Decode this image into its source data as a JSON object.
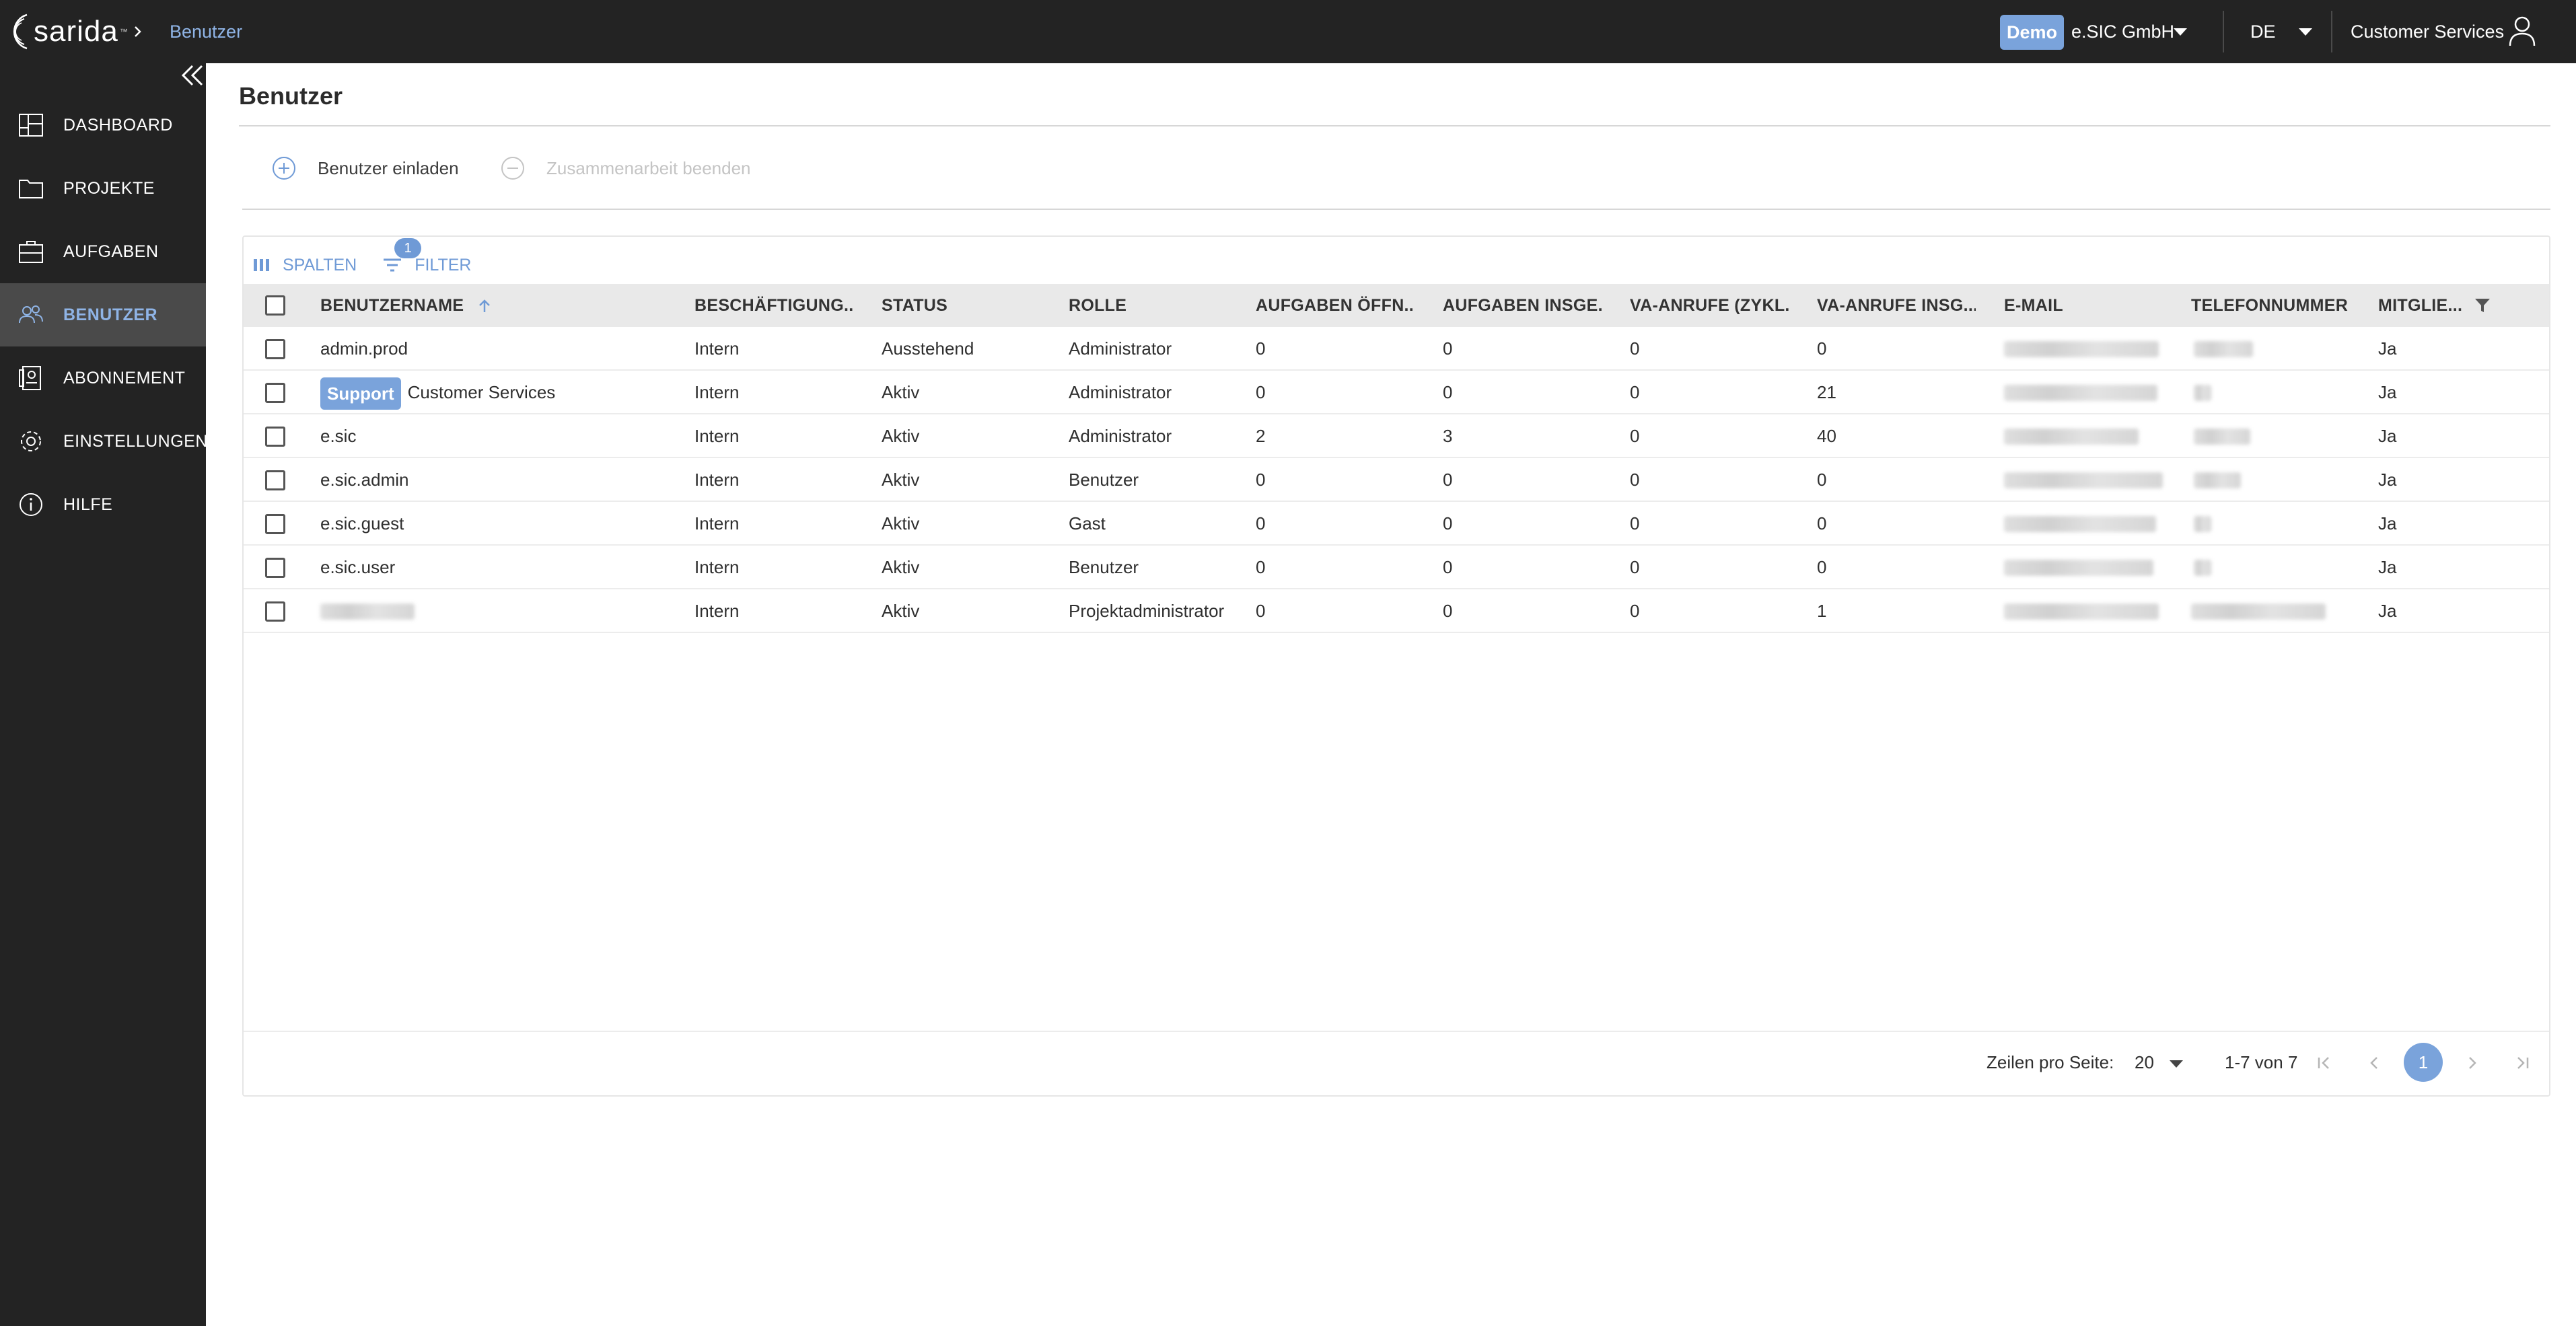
{
  "app": {
    "logo_text": "sarida",
    "breadcrumb_current": "Benutzer",
    "tenant_badge": "Demo",
    "company": "e.SIC GmbH",
    "language": "DE",
    "user": "Customer Services",
    "accent_color": "#7aa3db"
  },
  "sidebar": {
    "items": [
      {
        "label": "DASHBOARD",
        "icon": "dashboard-icon"
      },
      {
        "label": "PROJEKTE",
        "icon": "folder-icon"
      },
      {
        "label": "AUFGABEN",
        "icon": "tasks-icon"
      },
      {
        "label": "BENUTZER",
        "icon": "users-icon",
        "active": true
      },
      {
        "label": "ABONNEMENT",
        "icon": "subscription-icon"
      },
      {
        "label": "EINSTELLUNGEN",
        "icon": "gear-icon"
      },
      {
        "label": "HILFE",
        "icon": "info-icon"
      }
    ]
  },
  "page": {
    "title": "Benutzer",
    "invite_label": "Benutzer einladen",
    "end_collab_label": "Zusammenarbeit beenden"
  },
  "grid": {
    "columns_label": "SPALTEN",
    "filter_label": "FILTER",
    "filter_count": "1",
    "headers": [
      "BENUTZERNAME",
      "BESCHÄFTIGUNG...",
      "STATUS",
      "ROLLE",
      "AUFGABEN ÖFFN...",
      "AUFGABEN INSGE...",
      "VA-ANRUFE (ZYKL...",
      "VA-ANRUFE INSG...",
      "E-MAIL",
      "TELEFONNUMMER",
      "MITGLIE..."
    ],
    "rows": [
      {
        "username": "admin.prod",
        "badge": "",
        "employment": "Intern",
        "status": "Ausstehend",
        "role": "Administrator",
        "tasks_open": "0",
        "tasks_total": "0",
        "va_cycle": "0",
        "va_total": "0",
        "member": "Ja"
      },
      {
        "username": "Customer Services",
        "badge": "Support",
        "employment": "Intern",
        "status": "Aktiv",
        "role": "Administrator",
        "tasks_open": "0",
        "tasks_total": "0",
        "va_cycle": "0",
        "va_total": "21",
        "member": "Ja"
      },
      {
        "username": "e.sic",
        "badge": "",
        "employment": "Intern",
        "status": "Aktiv",
        "role": "Administrator",
        "tasks_open": "2",
        "tasks_total": "3",
        "va_cycle": "0",
        "va_total": "40",
        "member": "Ja"
      },
      {
        "username": "e.sic.admin",
        "badge": "",
        "employment": "Intern",
        "status": "Aktiv",
        "role": "Benutzer",
        "tasks_open": "0",
        "tasks_total": "0",
        "va_cycle": "0",
        "va_total": "0",
        "member": "Ja"
      },
      {
        "username": "e.sic.guest",
        "badge": "",
        "employment": "Intern",
        "status": "Aktiv",
        "role": "Gast",
        "tasks_open": "0",
        "tasks_total": "0",
        "va_cycle": "0",
        "va_total": "0",
        "member": "Ja"
      },
      {
        "username": "e.sic.user",
        "badge": "",
        "employment": "Intern",
        "status": "Aktiv",
        "role": "Benutzer",
        "tasks_open": "0",
        "tasks_total": "0",
        "va_cycle": "0",
        "va_total": "0",
        "member": "Ja"
      },
      {
        "username": "",
        "badge": "",
        "employment": "Intern",
        "status": "Aktiv",
        "role": "Projektadministrator",
        "tasks_open": "0",
        "tasks_total": "0",
        "va_cycle": "0",
        "va_total": "1",
        "member": "Ja"
      }
    ]
  },
  "pagination": {
    "rows_per_page_label": "Zeilen pro Seite:",
    "rows_per_page": "20",
    "range": "1-7 von 7",
    "current_page": "1"
  }
}
